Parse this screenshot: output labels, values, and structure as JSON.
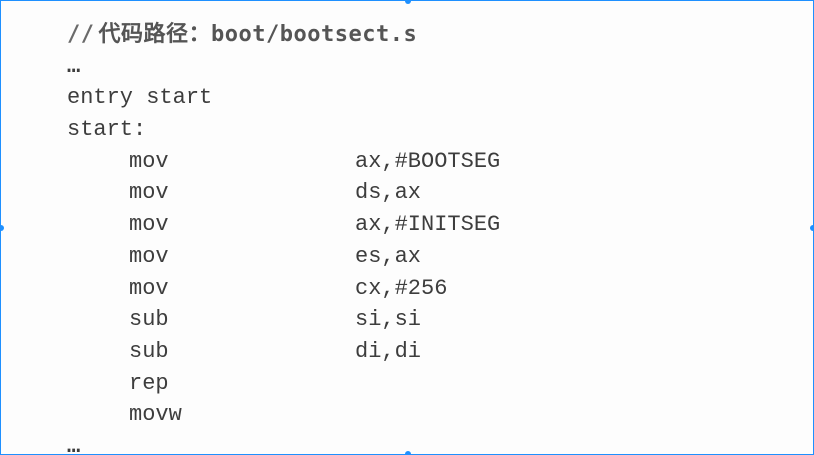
{
  "comment": {
    "slashes": "//",
    "label": "代码路径：",
    "path": "boot/bootsect.s"
  },
  "ellipsis_top": "…",
  "lines": [
    {
      "text": "entry start"
    },
    {
      "text": "start:"
    }
  ],
  "instructions": [
    {
      "op": "mov",
      "args": "ax,#BOOTSEG"
    },
    {
      "op": "mov",
      "args": "ds,ax"
    },
    {
      "op": "mov",
      "args": "ax,#INITSEG"
    },
    {
      "op": "mov",
      "args": "es,ax"
    },
    {
      "op": "mov",
      "args": "cx,#256"
    },
    {
      "op": "sub",
      "args": "si,si"
    },
    {
      "op": "sub",
      "args": "di,di"
    },
    {
      "op": "rep",
      "args": ""
    },
    {
      "op": "movw",
      "args": ""
    }
  ],
  "ellipsis_bottom": "…",
  "colors": {
    "selection_border": "#1e90ff",
    "text": "#3d3d3d"
  }
}
